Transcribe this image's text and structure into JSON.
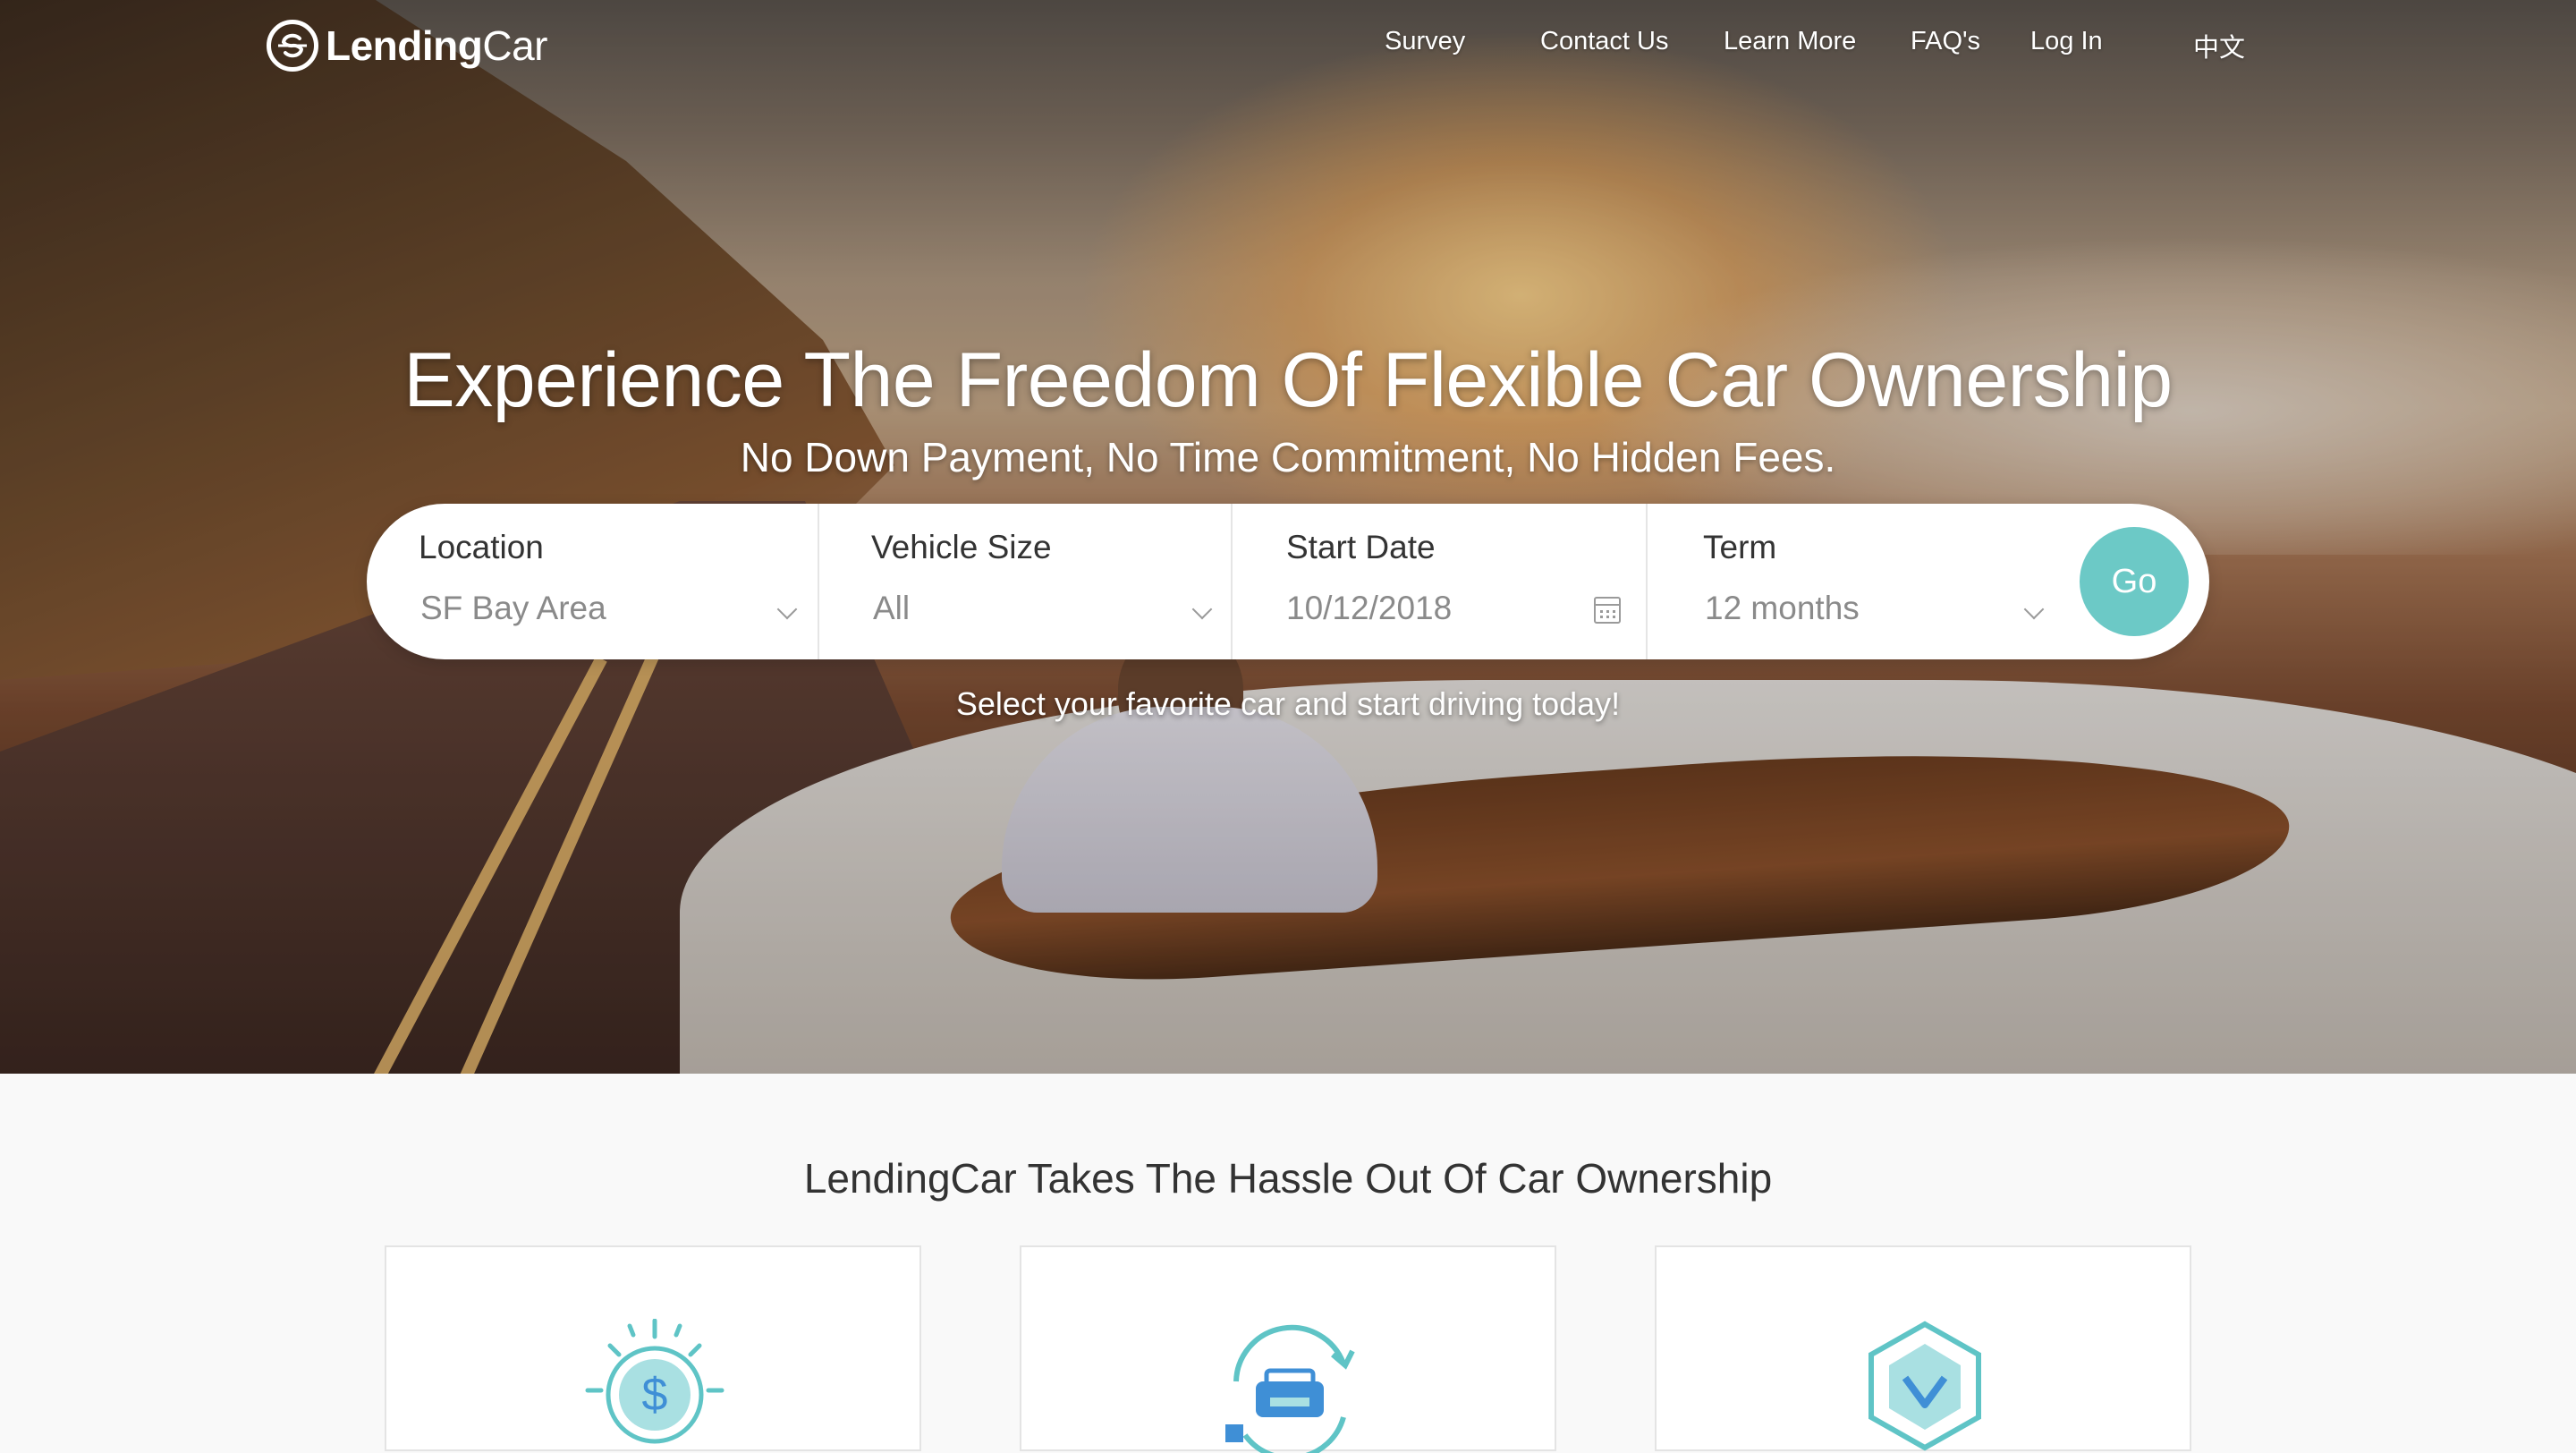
{
  "nav": {
    "logo_text_bold": "Lending",
    "logo_text_light": "Car",
    "links": [
      "Survey",
      "Contact Us",
      "Learn More",
      "FAQ's",
      "Log In",
      "中文"
    ]
  },
  "hero": {
    "headline": "Experience The Freedom Of Flexible Car Ownership",
    "subhead": "No Down Payment, No Time Commitment, No Hidden Fees.",
    "tagline": "Select your favorite car and start driving today!"
  },
  "search": {
    "location": {
      "label": "Location",
      "value": "SF Bay Area"
    },
    "vehicle_size": {
      "label": "Vehicle Size",
      "value": "All"
    },
    "start_date": {
      "label": "Start Date",
      "value": "10/12/2018"
    },
    "term": {
      "label": "Term",
      "value": "12 months"
    },
    "go_label": "Go"
  },
  "features": {
    "title": "LendingCar Takes The Hassle Out Of Car Ownership",
    "cards": [
      {
        "icon": "dollar-coin-icon"
      },
      {
        "icon": "car-cycle-icon"
      },
      {
        "icon": "shield-check-icon"
      }
    ]
  },
  "colors": {
    "accent": "#6cc9c6",
    "icon_blue": "#3f8fd6",
    "icon_teal": "#5fc4c6"
  }
}
